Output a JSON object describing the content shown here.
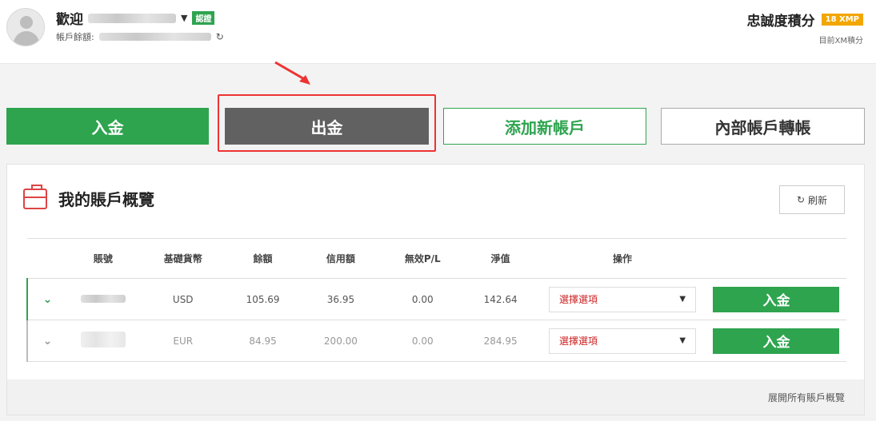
{
  "header": {
    "welcome": "歡迎",
    "verified": "認證",
    "balance_label": "帳戶餘額:",
    "loyalty_title": "忠誠度積分",
    "loyalty_badge": "18 XMP",
    "loyalty_sub": "目前XM積分"
  },
  "actions": {
    "deposit": "入金",
    "withdraw": "出金",
    "add_account": "添加新帳戶",
    "internal_transfer": "內部帳戶轉帳"
  },
  "panel": {
    "title": "我的賬戶概覽",
    "refresh": "刷新",
    "footer": "展開所有賬戶概覽",
    "columns": [
      "",
      "賬號",
      "基礎貨幣",
      "餘額",
      "信用額",
      "無效P/L",
      "淨值",
      "操作",
      ""
    ],
    "rows": [
      {
        "currency": "USD",
        "balance": "105.69",
        "credit": "36.95",
        "pl": "0.00",
        "equity": "142.64",
        "select": "選擇選項",
        "action": "入金"
      },
      {
        "currency": "EUR",
        "balance": "84.95",
        "credit": "200.00",
        "pl": "0.00",
        "equity": "284.95",
        "select": "選擇選項",
        "action": "入金"
      }
    ]
  },
  "colors": {
    "accent": "#2ea44f",
    "withdraw": "#616161",
    "highlight": "#ee3333",
    "badge": "#f2a600"
  }
}
